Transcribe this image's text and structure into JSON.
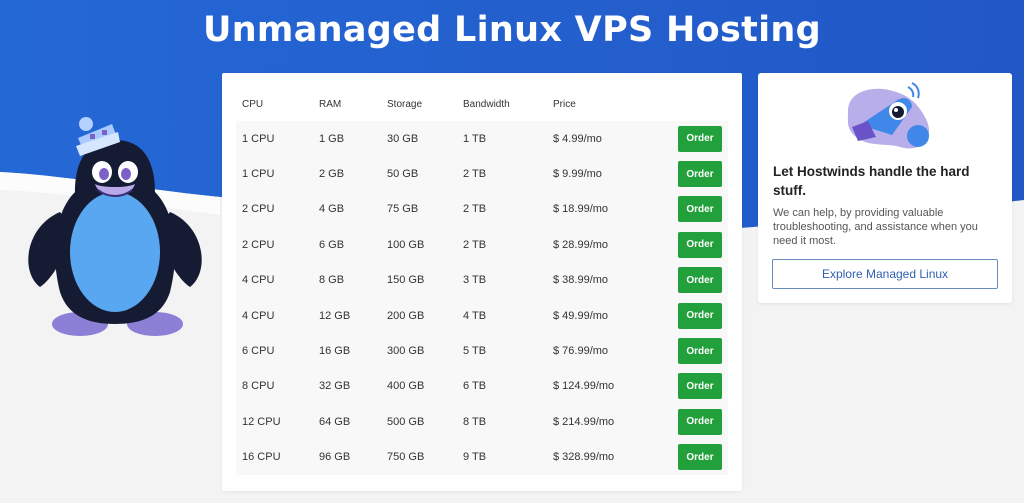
{
  "page": {
    "title": "Unmanaged Linux VPS Hosting",
    "colors": {
      "hero_blue": "#2360cf",
      "background": "#f3f3f3",
      "order_green": "#22a03b",
      "explore_blue": "#2f5fb2"
    }
  },
  "pricing": {
    "columns": [
      "CPU",
      "RAM",
      "Storage",
      "Bandwidth",
      "Price"
    ],
    "action_label": "Order",
    "rows": [
      {
        "cpu": "1 CPU",
        "ram": "1 GB",
        "storage": "30 GB",
        "bandwidth": "1 TB",
        "price": "$ 4.99/mo"
      },
      {
        "cpu": "1 CPU",
        "ram": "2 GB",
        "storage": "50 GB",
        "bandwidth": "2 TB",
        "price": "$ 9.99/mo"
      },
      {
        "cpu": "2 CPU",
        "ram": "4 GB",
        "storage": "75 GB",
        "bandwidth": "2 TB",
        "price": "$ 18.99/mo"
      },
      {
        "cpu": "2 CPU",
        "ram": "6 GB",
        "storage": "100 GB",
        "bandwidth": "2 TB",
        "price": "$ 28.99/mo"
      },
      {
        "cpu": "4 CPU",
        "ram": "8 GB",
        "storage": "150 GB",
        "bandwidth": "3 TB",
        "price": "$ 38.99/mo"
      },
      {
        "cpu": "4 CPU",
        "ram": "12 GB",
        "storage": "200 GB",
        "bandwidth": "4 TB",
        "price": "$ 49.99/mo"
      },
      {
        "cpu": "6 CPU",
        "ram": "16 GB",
        "storage": "300 GB",
        "bandwidth": "5 TB",
        "price": "$ 76.99/mo"
      },
      {
        "cpu": "8 CPU",
        "ram": "32 GB",
        "storage": "400 GB",
        "bandwidth": "6 TB",
        "price": "$ 124.99/mo"
      },
      {
        "cpu": "12 CPU",
        "ram": "64 GB",
        "storage": "500 GB",
        "bandwidth": "8 TB",
        "price": "$ 214.99/mo"
      },
      {
        "cpu": "16 CPU",
        "ram": "96 GB",
        "storage": "750 GB",
        "bandwidth": "9 TB",
        "price": "$ 328.99/mo"
      }
    ]
  },
  "managed": {
    "illustration_icon": "rocket-illustration-icon",
    "heading": "Let Hostwinds handle the hard stuff.",
    "description": "We can help, by providing valuable troubleshooting, and assistance when you need it most.",
    "button_label": "Explore Managed Linux"
  },
  "mascot": {
    "icon": "penguin-mascot-icon"
  }
}
